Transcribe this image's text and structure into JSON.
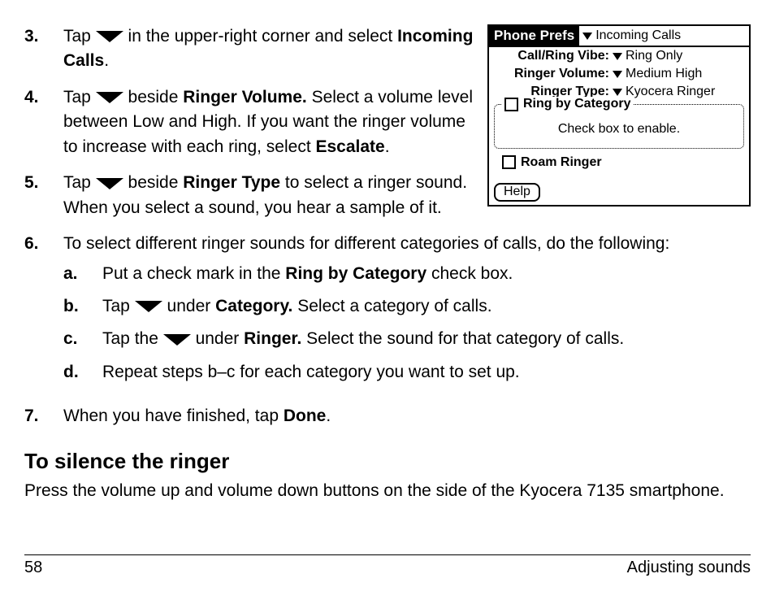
{
  "screenshot": {
    "title": "Phone Prefs",
    "header_menu": "Incoming Calls",
    "rows": [
      {
        "label": "Call/Ring Vibe:",
        "value": "Ring Only"
      },
      {
        "label": "Ringer Volume:",
        "value": "Medium High"
      },
      {
        "label": "Ringer Type:",
        "value": "Kyocera Ringer"
      }
    ],
    "group_title": "Ring by Category",
    "group_hint": "Check box to enable.",
    "roam_label": "Roam Ringer",
    "help_label": "Help"
  },
  "steps": {
    "s3": {
      "num": "3.",
      "t1": "Tap ",
      "t2": " in the upper-right corner and select ",
      "b1": "Incoming Calls",
      "t3": "."
    },
    "s4": {
      "num": "4.",
      "t1": "Tap ",
      "t2": " beside ",
      "b1": "Ringer Volume. ",
      "t3": "Select a volume level between Low and High. If you want the ringer volume to increase with each ring, select ",
      "b2": "Escalate",
      "t4": "."
    },
    "s5": {
      "num": "5.",
      "t1": "Tap ",
      "t2": " beside ",
      "b1": "Ringer Type",
      "t3": " to select a ringer sound. When you select a sound, you hear a sample of it."
    },
    "s6": {
      "num": "6.",
      "t1": "To select different ringer sounds for different categories of calls, do the following:"
    },
    "s6a": {
      "num": "a.",
      "t1": "Put a check mark in the ",
      "b1": "Ring by Category",
      "t2": " check box."
    },
    "s6b": {
      "num": "b.",
      "t1": "Tap ",
      "t2": " under ",
      "b1": "Category.",
      "t3": " Select a category of calls."
    },
    "s6c": {
      "num": "c.",
      "t1": "Tap the ",
      "t2": " under ",
      "b1": "Ringer.",
      "t3": " Select the sound for that category of calls."
    },
    "s6d": {
      "num": "d.",
      "t1": "Repeat steps b–c for each category you want to set up."
    },
    "s7": {
      "num": "7.",
      "t1": "When you have finished, tap ",
      "b1": "Done",
      "t2": "."
    }
  },
  "section_heading": "To silence the ringer",
  "section_body": "Press the volume up and volume down buttons on the side of the Kyocera 7135 smartphone.",
  "footer": {
    "page": "58",
    "chapter": "Adjusting sounds"
  }
}
